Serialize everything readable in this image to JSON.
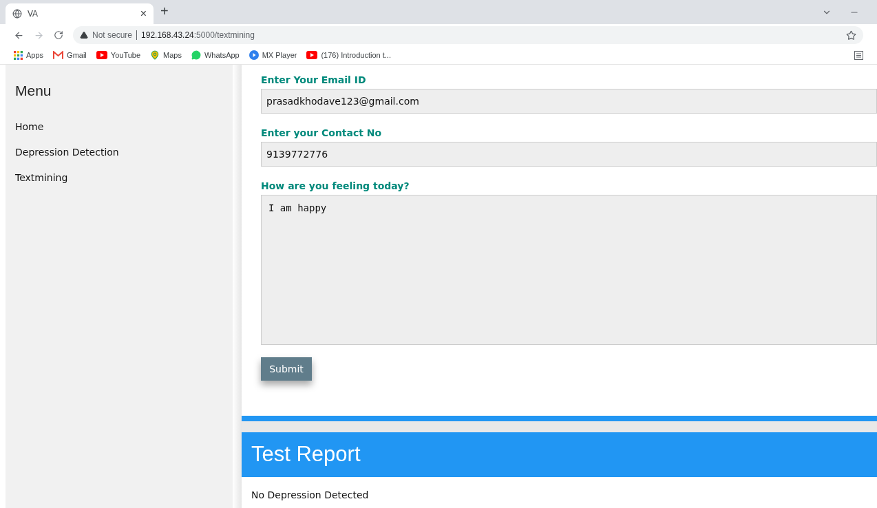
{
  "browser": {
    "tab": {
      "title": "VA",
      "close": "×"
    },
    "new_tab": "+",
    "address": {
      "security": "Not secure",
      "host": "192.168.43.24",
      "path": ":5000/textmining"
    },
    "bookmarks": [
      {
        "label": "Apps",
        "kind": "apps"
      },
      {
        "label": "Gmail",
        "kind": "gmail"
      },
      {
        "label": "YouTube",
        "kind": "youtube"
      },
      {
        "label": "Maps",
        "kind": "maps"
      },
      {
        "label": "WhatsApp",
        "kind": "whatsapp"
      },
      {
        "label": "MX Player",
        "kind": "play"
      },
      {
        "label": "(176) Introduction t...",
        "kind": "youtube"
      }
    ]
  },
  "sidebar": {
    "title": "Menu",
    "items": [
      {
        "label": "Home"
      },
      {
        "label": "Depression Detection"
      },
      {
        "label": "Textmining"
      }
    ]
  },
  "form": {
    "fields": [
      {
        "label": "Enter Your Email ID",
        "value": "prasadkhodave123@gmail.com",
        "kind": "input"
      },
      {
        "label": "Enter your Contact No",
        "value": "9139772776",
        "kind": "input"
      },
      {
        "label": "How are you feeling today?",
        "value": "I am happy",
        "kind": "textarea"
      }
    ],
    "submit": "Submit"
  },
  "report": {
    "title": "Test Report",
    "result": "No Depression Detected"
  }
}
